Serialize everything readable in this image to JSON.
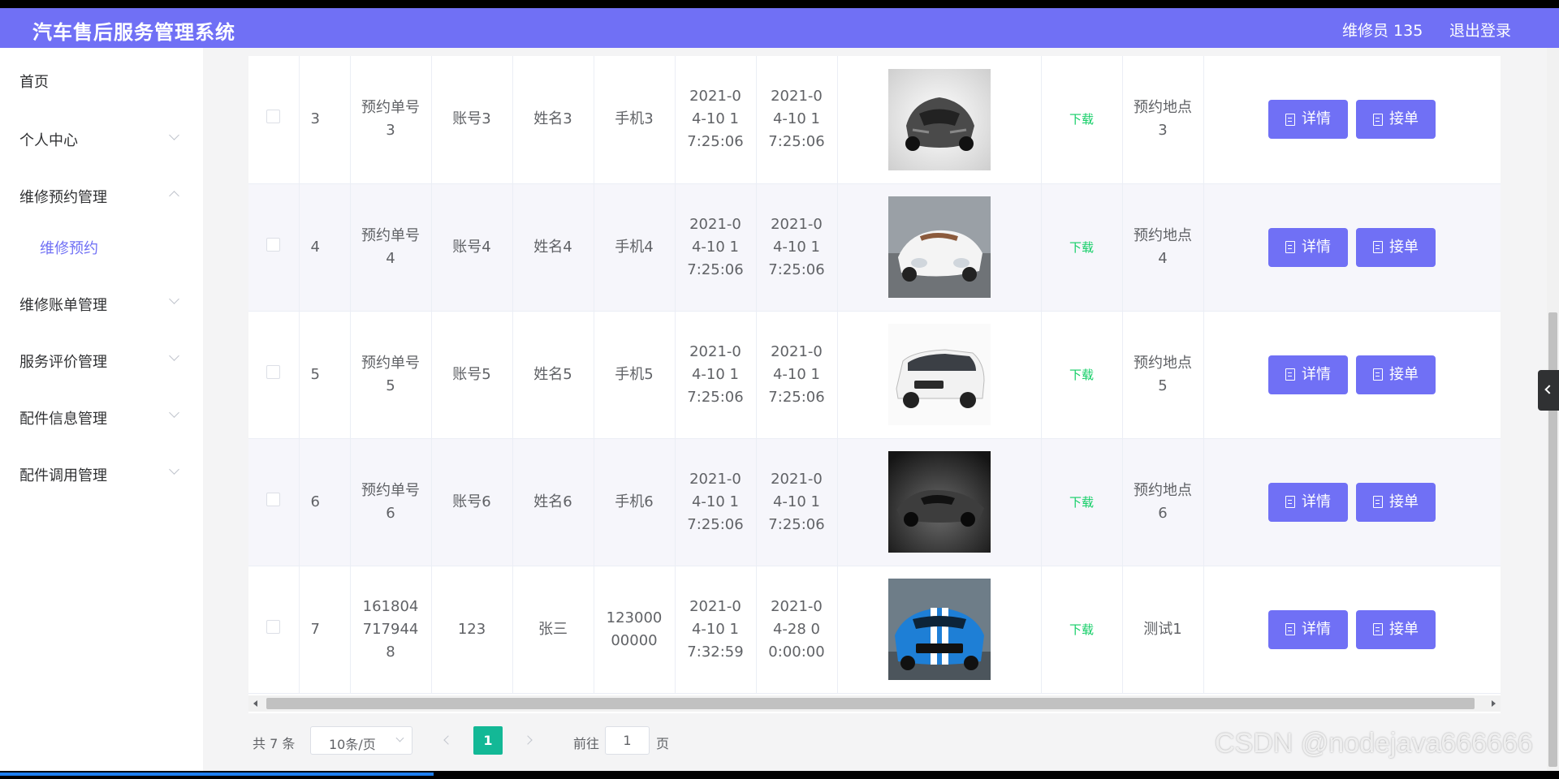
{
  "header": {
    "title": "汽车售后服务管理系统",
    "user": "维修员 135",
    "logout": "退出登录"
  },
  "sidebar": {
    "items": [
      {
        "label": "首页"
      },
      {
        "label": "个人中心"
      },
      {
        "label": "维修预约管理",
        "expanded": true,
        "children": [
          {
            "label": "维修预约",
            "active": true
          }
        ]
      },
      {
        "label": "维修账单管理"
      },
      {
        "label": "服务评价管理"
      },
      {
        "label": "配件信息管理"
      },
      {
        "label": "配件调用管理"
      }
    ]
  },
  "table": {
    "rows": [
      {
        "idx": "3",
        "order_no": "预约单号3",
        "account": "账号3",
        "name": "姓名3",
        "phone": "手机3",
        "time1": "2021-04-10 17:25:06",
        "time2": "2021-04-10 17:25:06",
        "image": "car-photo-gray-supercar",
        "download": "下载",
        "location": "预约地点3"
      },
      {
        "idx": "4",
        "order_no": "预约单号4",
        "account": "账号4",
        "name": "姓名4",
        "phone": "手机4",
        "time1": "2021-04-10 17:25:06",
        "time2": "2021-04-10 17:25:06",
        "image": "car-photo-white-roadster",
        "download": "下载",
        "location": "预约地点4"
      },
      {
        "idx": "5",
        "order_no": "预约单号5",
        "account": "账号5",
        "name": "姓名5",
        "phone": "手机5",
        "time1": "2021-04-10 17:25:06",
        "time2": "2021-04-10 17:25:06",
        "image": "car-photo-white-minivan",
        "download": "下载",
        "location": "预约地点5"
      },
      {
        "idx": "6",
        "order_no": "预约单号6",
        "account": "账号6",
        "name": "姓名6",
        "phone": "手机6",
        "time1": "2021-04-10 17:25:06",
        "time2": "2021-04-10 17:25:06",
        "image": "car-photo-dark-concept",
        "download": "下载",
        "location": "预约地点6"
      },
      {
        "idx": "7",
        "order_no": "1618047179448",
        "account": "123",
        "name": "张三",
        "phone": "12300000000",
        "time1": "2021-04-10 17:32:59",
        "time2": "2021-04-28 00:00:00",
        "image": "car-photo-blue-mustang",
        "download": "下载",
        "location": "测试1"
      }
    ],
    "actions": {
      "detail": "详情",
      "accept": "接单"
    }
  },
  "pagination": {
    "total": "共 7 条",
    "page_size": "10条/页",
    "current_page": "1",
    "goto_label": "前往",
    "goto_value": "1",
    "page_unit": "页"
  },
  "watermark": "CSDN @nodejava666666",
  "colors": {
    "primary": "#7070f5",
    "success": "#13ce66",
    "page_active": "#13b896"
  }
}
